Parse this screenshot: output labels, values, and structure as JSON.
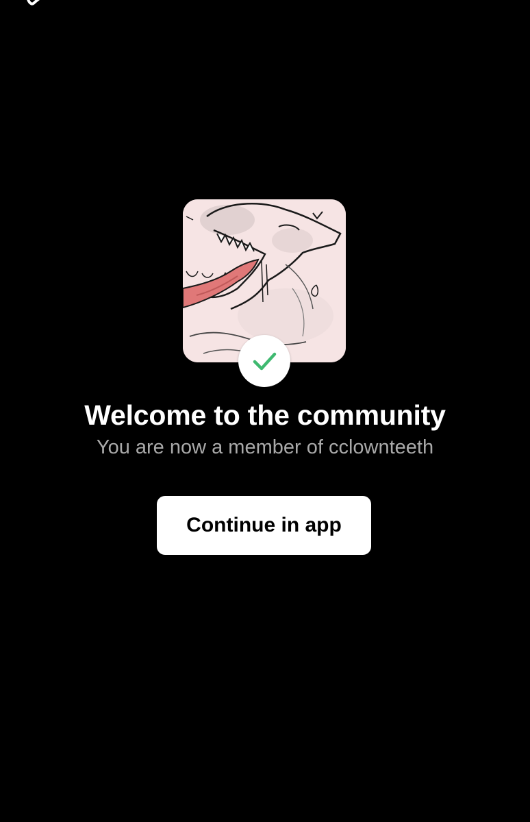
{
  "colors": {
    "background": "#000000",
    "title": "#ffffff",
    "subtitle": "#a9a9a9",
    "button_bg": "#ffffff",
    "button_text": "#000000",
    "check": "#3fb970",
    "card_bg": "#f6e4e4"
  },
  "community": {
    "avatar_icon": "community-avatar-art",
    "badge_icon": "checkmark-icon"
  },
  "welcome": {
    "title": "Welcome to the community",
    "subtitle": "You are now a member of cclownteeth"
  },
  "actions": {
    "continue_label": "Continue in app"
  }
}
